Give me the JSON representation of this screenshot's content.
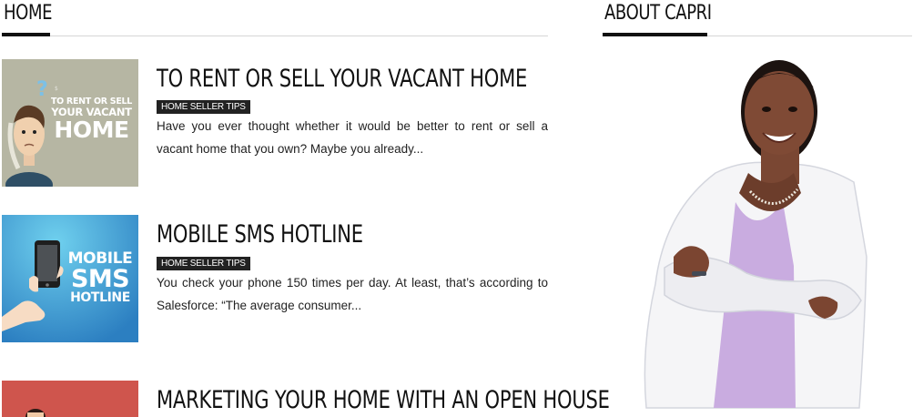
{
  "sections": {
    "home_title": "HOME",
    "about_title": "ABOUT CAPRI"
  },
  "posts": [
    {
      "title": "TO RENT OR SELL YOUR VACANT HOME",
      "category": "HOME SELLER TIPS",
      "excerpt": "Have you ever thought whether it would be better to rent or sell a vacant home that you own? Maybe you already...",
      "thumb_lines": [
        "TO RENT OR SELL",
        "YOUR VACANT",
        "HOME"
      ]
    },
    {
      "title": "MOBILE SMS HOTLINE",
      "category": "HOME SELLER TIPS",
      "excerpt": "You check your phone 150 times per day. At least, that’s according to Salesforce: “The average consumer...",
      "thumb_lines": [
        "MOBILE",
        "SMS",
        "HOTLINE"
      ]
    },
    {
      "title": "MARKETING YOUR HOME WITH AN OPEN HOUSE"
    }
  ],
  "colors": {
    "accent_bar": "#111111",
    "badge_bg": "#222222",
    "thumb1_bg": "#a9a995",
    "thumb2_bg": "#3b8fc9",
    "thumb3_bg": "#c9504a"
  }
}
